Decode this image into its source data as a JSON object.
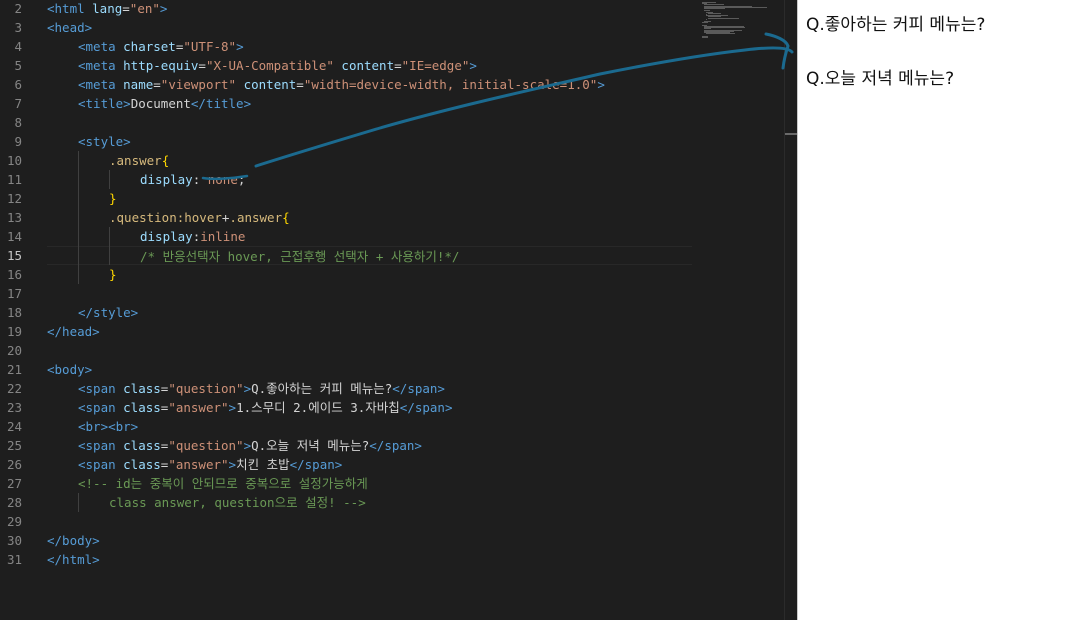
{
  "editor": {
    "active_line": "15",
    "lines": [
      {
        "no": "2",
        "indent": 0,
        "tokens": [
          {
            "c": "t-tag",
            "t": "<html "
          },
          {
            "c": "t-attr",
            "t": "lang"
          },
          {
            "c": "t-txt",
            "t": "="
          },
          {
            "c": "t-str",
            "t": "\"en\""
          },
          {
            "c": "t-tag",
            "t": ">"
          }
        ]
      },
      {
        "no": "3",
        "indent": 0,
        "tokens": [
          {
            "c": "t-tag",
            "t": "<head>"
          }
        ]
      },
      {
        "no": "4",
        "indent": 1,
        "tokens": [
          {
            "c": "t-tag",
            "t": "<meta "
          },
          {
            "c": "t-attr",
            "t": "charset"
          },
          {
            "c": "t-txt",
            "t": "="
          },
          {
            "c": "t-str",
            "t": "\"UTF-8\""
          },
          {
            "c": "t-tag",
            "t": ">"
          }
        ]
      },
      {
        "no": "5",
        "indent": 1,
        "tokens": [
          {
            "c": "t-tag",
            "t": "<meta "
          },
          {
            "c": "t-attr",
            "t": "http-equiv"
          },
          {
            "c": "t-txt",
            "t": "="
          },
          {
            "c": "t-str",
            "t": "\"X-UA-Compatible\""
          },
          {
            "c": "t-txt",
            "t": " "
          },
          {
            "c": "t-attr",
            "t": "content"
          },
          {
            "c": "t-txt",
            "t": "="
          },
          {
            "c": "t-str",
            "t": "\"IE=edge\""
          },
          {
            "c": "t-tag",
            "t": ">"
          }
        ]
      },
      {
        "no": "6",
        "indent": 1,
        "tokens": [
          {
            "c": "t-tag",
            "t": "<meta "
          },
          {
            "c": "t-attr",
            "t": "name"
          },
          {
            "c": "t-txt",
            "t": "="
          },
          {
            "c": "t-str",
            "t": "\"viewport\""
          },
          {
            "c": "t-txt",
            "t": " "
          },
          {
            "c": "t-attr",
            "t": "content"
          },
          {
            "c": "t-txt",
            "t": "="
          },
          {
            "c": "t-str",
            "t": "\"width=device-width, initial-scale=1.0\""
          },
          {
            "c": "t-tag",
            "t": ">"
          }
        ]
      },
      {
        "no": "7",
        "indent": 1,
        "tokens": [
          {
            "c": "t-tag",
            "t": "<title>"
          },
          {
            "c": "t-txt",
            "t": "Document"
          },
          {
            "c": "t-tag",
            "t": "</title>"
          }
        ]
      },
      {
        "no": "8",
        "indent": 0,
        "tokens": []
      },
      {
        "no": "9",
        "indent": 1,
        "tokens": [
          {
            "c": "t-tag",
            "t": "<style>"
          }
        ]
      },
      {
        "no": "10",
        "indent": 2,
        "tokens": [
          {
            "c": "t-sel",
            "t": ".answer"
          },
          {
            "c": "t-brace",
            "t": "{"
          }
        ]
      },
      {
        "no": "11",
        "indent": 3,
        "tokens": [
          {
            "c": "t-prop",
            "t": "display"
          },
          {
            "c": "t-txt",
            "t": ": "
          },
          {
            "c": "t-val",
            "t": "none"
          },
          {
            "c": "t-txt",
            "t": ";"
          }
        ]
      },
      {
        "no": "12",
        "indent": 2,
        "tokens": [
          {
            "c": "t-brace",
            "t": "}"
          }
        ]
      },
      {
        "no": "13",
        "indent": 2,
        "tokens": [
          {
            "c": "t-sel",
            "t": ".question:hover"
          },
          {
            "c": "t-txt",
            "t": "+"
          },
          {
            "c": "t-sel",
            "t": ".answer"
          },
          {
            "c": "t-brace",
            "t": "{"
          }
        ]
      },
      {
        "no": "14",
        "indent": 3,
        "tokens": [
          {
            "c": "t-prop",
            "t": "display"
          },
          {
            "c": "t-txt",
            "t": ":"
          },
          {
            "c": "t-val",
            "t": "inline"
          }
        ]
      },
      {
        "no": "15",
        "indent": 3,
        "tokens": [
          {
            "c": "t-com",
            "t": "/* 반응선택자 hover, 근접후행 선택자 + 사용하기!*/"
          }
        ]
      },
      {
        "no": "16",
        "indent": 2,
        "tokens": [
          {
            "c": "t-brace",
            "t": "}"
          }
        ]
      },
      {
        "no": "17",
        "indent": 0,
        "tokens": []
      },
      {
        "no": "18",
        "indent": 1,
        "tokens": [
          {
            "c": "t-tag",
            "t": "</style>"
          }
        ]
      },
      {
        "no": "19",
        "indent": 0,
        "tokens": [
          {
            "c": "t-tag",
            "t": "</head>"
          }
        ]
      },
      {
        "no": "20",
        "indent": 0,
        "tokens": []
      },
      {
        "no": "21",
        "indent": 0,
        "tokens": [
          {
            "c": "t-tag",
            "t": "<body>"
          }
        ]
      },
      {
        "no": "22",
        "indent": 1,
        "tokens": [
          {
            "c": "t-tag",
            "t": "<span "
          },
          {
            "c": "t-attr",
            "t": "class"
          },
          {
            "c": "t-txt",
            "t": "="
          },
          {
            "c": "t-str",
            "t": "\"question\""
          },
          {
            "c": "t-tag",
            "t": ">"
          },
          {
            "c": "t-txt",
            "t": "Q.좋아하는 커피 메뉴는?"
          },
          {
            "c": "t-tag",
            "t": "</span>"
          }
        ]
      },
      {
        "no": "23",
        "indent": 1,
        "tokens": [
          {
            "c": "t-tag",
            "t": "<span "
          },
          {
            "c": "t-attr",
            "t": "class"
          },
          {
            "c": "t-txt",
            "t": "="
          },
          {
            "c": "t-str",
            "t": "\"answer\""
          },
          {
            "c": "t-tag",
            "t": ">"
          },
          {
            "c": "t-txt",
            "t": "1.스무디 2.에이드 3.자바칩"
          },
          {
            "c": "t-tag",
            "t": "</span>"
          }
        ]
      },
      {
        "no": "24",
        "indent": 1,
        "tokens": [
          {
            "c": "t-tag",
            "t": "<br><br>"
          }
        ]
      },
      {
        "no": "25",
        "indent": 1,
        "tokens": [
          {
            "c": "t-tag",
            "t": "<span "
          },
          {
            "c": "t-attr",
            "t": "class"
          },
          {
            "c": "t-txt",
            "t": "="
          },
          {
            "c": "t-str",
            "t": "\"question\""
          },
          {
            "c": "t-tag",
            "t": ">"
          },
          {
            "c": "t-txt",
            "t": "Q.오늘 저녁 메뉴는?"
          },
          {
            "c": "t-tag",
            "t": "</span>"
          }
        ]
      },
      {
        "no": "26",
        "indent": 1,
        "tokens": [
          {
            "c": "t-tag",
            "t": "<span "
          },
          {
            "c": "t-attr",
            "t": "class"
          },
          {
            "c": "t-txt",
            "t": "="
          },
          {
            "c": "t-str",
            "t": "\"answer\""
          },
          {
            "c": "t-tag",
            "t": ">"
          },
          {
            "c": "t-txt",
            "t": "치킨 초밥"
          },
          {
            "c": "t-tag",
            "t": "</span>"
          }
        ]
      },
      {
        "no": "27",
        "indent": 1,
        "tokens": [
          {
            "c": "t-com",
            "t": "<!-- id는 중복이 안되므로 중복으로 설정가능하게"
          }
        ]
      },
      {
        "no": "28",
        "indent": 2,
        "tokens": [
          {
            "c": "t-com",
            "t": "class answer, question으로 설정! -->"
          }
        ]
      },
      {
        "no": "29",
        "indent": 0,
        "tokens": []
      },
      {
        "no": "30",
        "indent": 0,
        "tokens": [
          {
            "c": "t-tag",
            "t": "</body>"
          }
        ]
      },
      {
        "no": "31",
        "indent": 0,
        "tokens": [
          {
            "c": "t-tag",
            "t": "</html>"
          }
        ]
      }
    ]
  },
  "preview": {
    "question_1": "Q.좋아하는 커피 메뉴는?",
    "question_2": "Q.오늘 저녁 메뉴는?"
  },
  "colors": {
    "editor_bg": "#1e1e1e",
    "preview_bg": "#ffffff",
    "annotation_ink": "#1b6a8f"
  }
}
